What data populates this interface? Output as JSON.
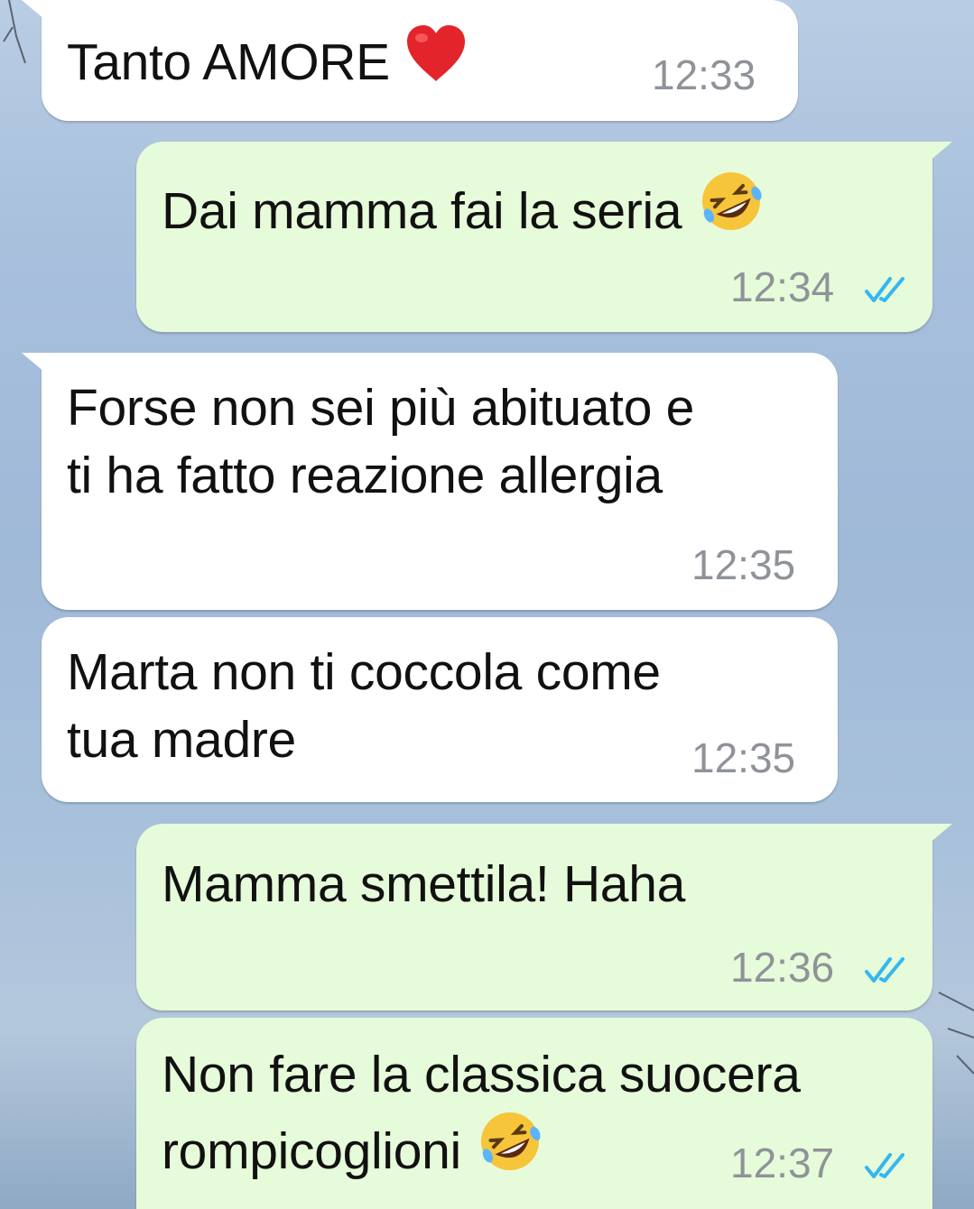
{
  "messages": [
    {
      "direction": "incoming",
      "text": "Tanto AMORE",
      "emoji": "red-heart",
      "time": "12:33"
    },
    {
      "direction": "outgoing",
      "text": "Dai mamma fai la seria",
      "emoji": "rolling-on-floor-laughing",
      "time": "12:34",
      "status": "read"
    },
    {
      "direction": "incoming",
      "text_line1": "Forse non sei più abituato e",
      "text_line2": "ti ha fatto reazione allergia",
      "time": "12:35"
    },
    {
      "direction": "incoming",
      "text_line1": "Marta non ti coccola come",
      "text_line2": "tua madre",
      "time": "12:35"
    },
    {
      "direction": "outgoing",
      "text": "Mamma smettila! Haha",
      "time": "12:36",
      "status": "read"
    },
    {
      "direction": "outgoing",
      "text_line1": "Non fare la classica suocera",
      "text_line2": "rompicoglioni",
      "emoji": "rolling-on-floor-laughing",
      "time": "12:37",
      "status": "read"
    }
  ],
  "colors": {
    "incoming_bubble": "#ffffff",
    "outgoing_bubble": "#e6fbd9",
    "timestamp": "#8f9399",
    "read_ticks": "#34b7f1"
  }
}
